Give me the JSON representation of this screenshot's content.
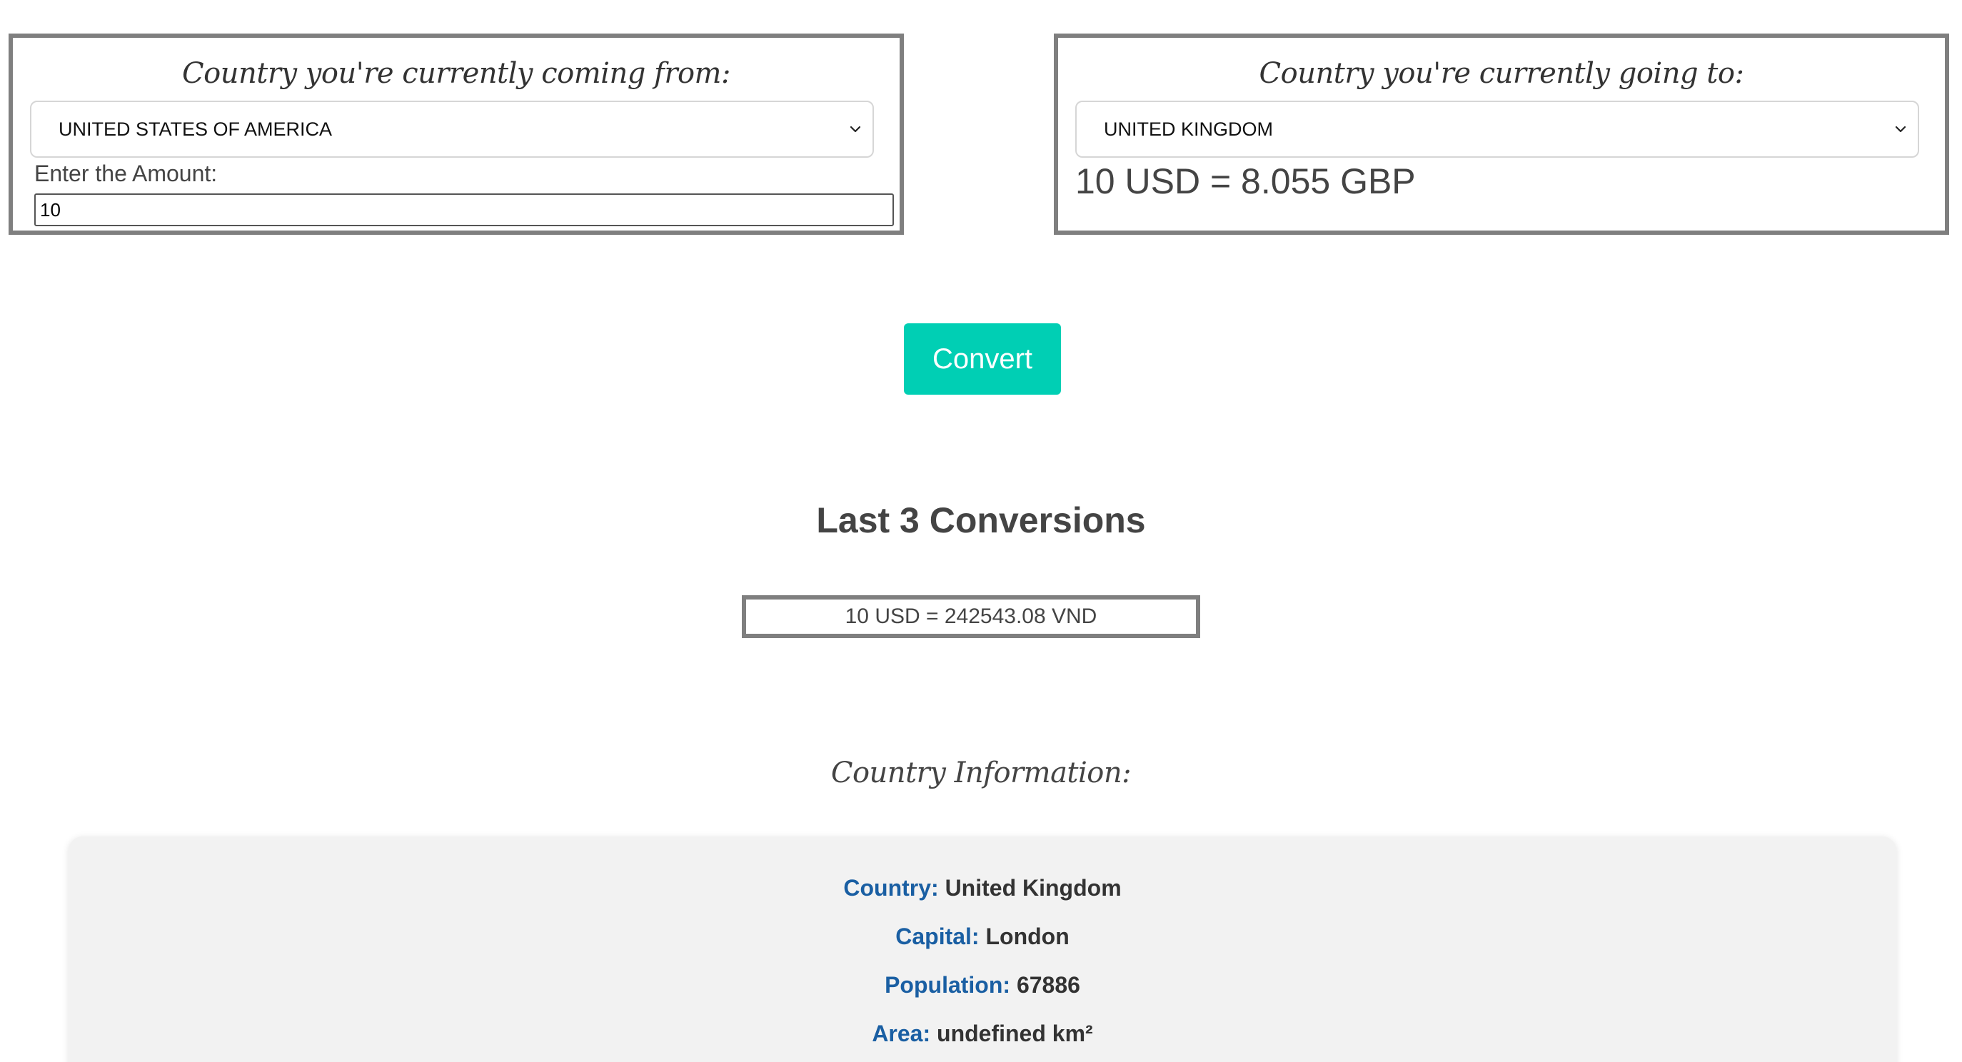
{
  "from_panel": {
    "heading": "Country you're currently coming from:",
    "selected_country": "UNITED STATES OF AMERICA",
    "amount_label": "Enter the Amount:",
    "amount_value": "10"
  },
  "to_panel": {
    "heading": "Country you're currently going to:",
    "selected_country": "UNITED KINGDOM",
    "result": "10 USD = 8.055 GBP"
  },
  "convert_button": {
    "label": "Convert",
    "color": "#00cfb4"
  },
  "history": {
    "title": "Last 3 Conversions",
    "items": [
      "10 USD = 242543.08 VND"
    ]
  },
  "country_info": {
    "heading": "Country Information:",
    "fields": [
      {
        "label": "Country:",
        "value": "United Kingdom"
      },
      {
        "label": "Capital:",
        "value": "London"
      },
      {
        "label": "Population:",
        "value": "67886"
      },
      {
        "label": "Area:",
        "value": "undefined km²"
      }
    ],
    "label_color": "#1a5fa3"
  },
  "icons": {
    "select_arrow": "chevron-down-icon"
  }
}
